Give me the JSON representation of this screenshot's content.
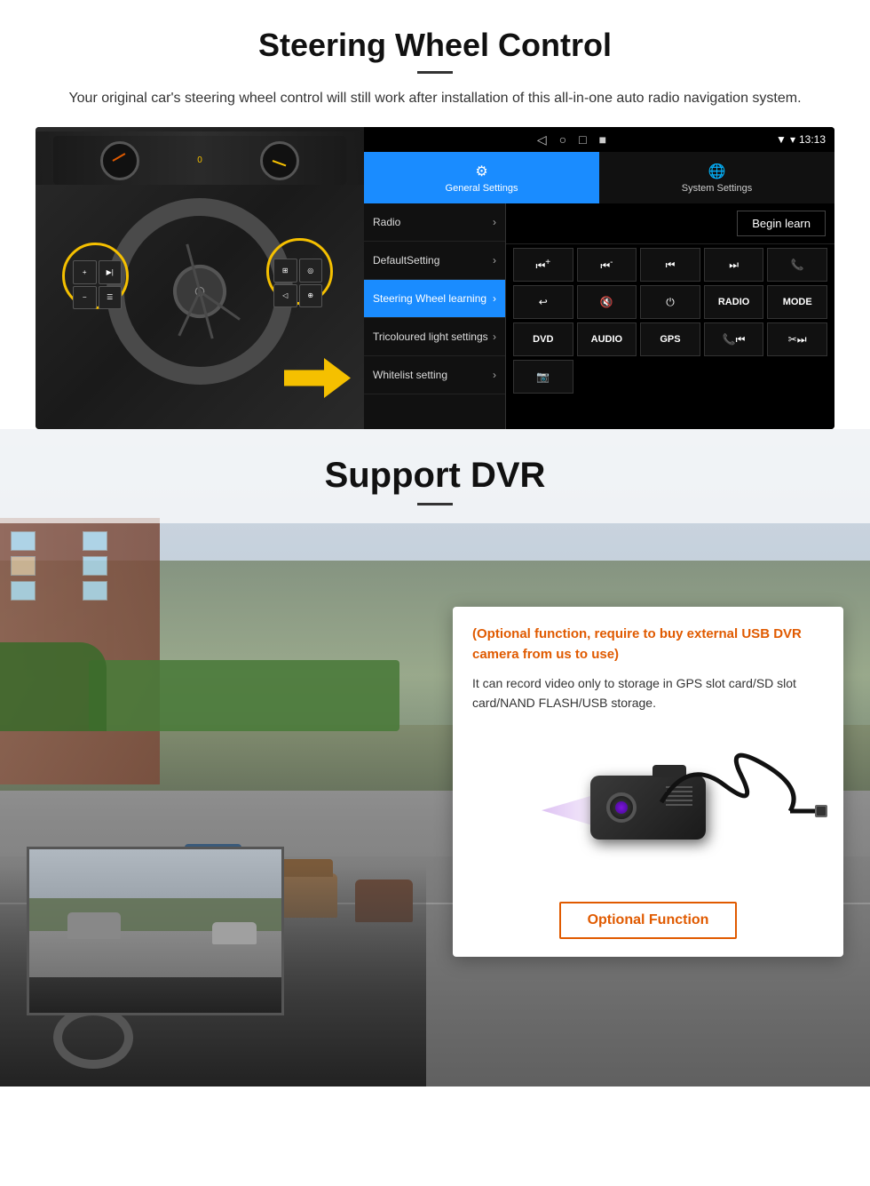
{
  "steering_section": {
    "title": "Steering Wheel Control",
    "subtitle": "Your original car's steering wheel control will still work after installation of this all-in-one auto radio navigation system.",
    "android_ui": {
      "statusbar": {
        "time": "13:13",
        "nav_icons": [
          "◁",
          "○",
          "□",
          "■"
        ]
      },
      "tabs": [
        {
          "icon": "⚙",
          "label": "General Settings",
          "active": true
        },
        {
          "icon": "🌐",
          "label": "System Settings",
          "active": false
        }
      ],
      "menu_items": [
        {
          "label": "Radio",
          "active": false
        },
        {
          "label": "DefaultSetting",
          "active": false
        },
        {
          "label": "Steering Wheel learning",
          "active": true
        },
        {
          "label": "Tricoloured light settings",
          "active": false
        },
        {
          "label": "Whitelist setting",
          "active": false
        }
      ],
      "begin_learn_label": "Begin learn",
      "control_buttons": [
        "⏮+",
        "⏮-",
        "⏮|",
        "|⏭",
        "📞",
        "↩",
        "🔇x",
        "⏻",
        "RADIO",
        "MODE",
        "DVD",
        "AUDIO",
        "GPS",
        "📞⏮|",
        "✂⏭|",
        "📷"
      ]
    }
  },
  "dvr_section": {
    "title": "Support DVR",
    "optional_text": "(Optional function, require to buy external USB DVR camera from us to use)",
    "description": "It can record video only to storage in GPS slot card/SD slot card/NAND FLASH/USB storage.",
    "optional_button_label": "Optional Function"
  }
}
